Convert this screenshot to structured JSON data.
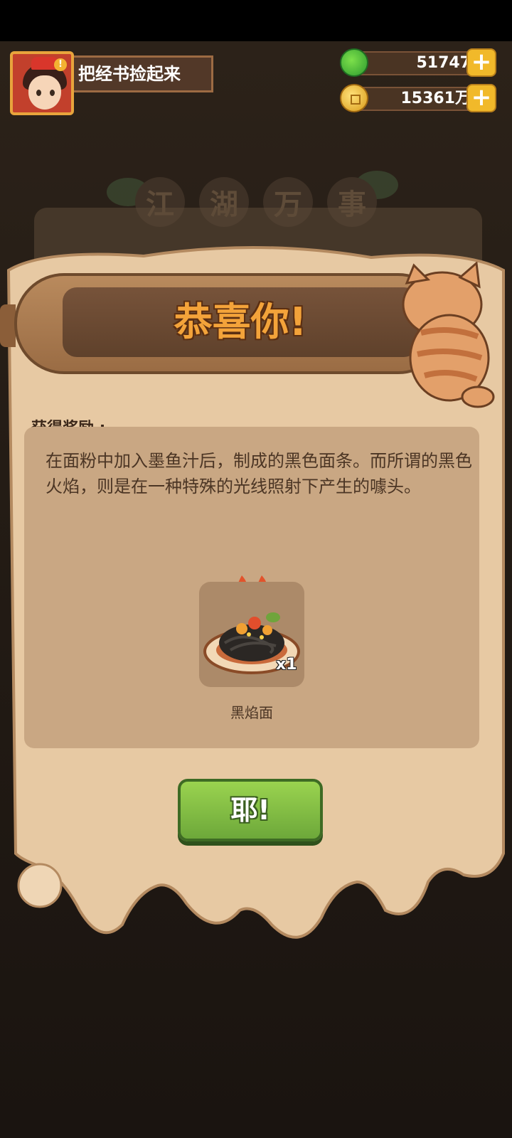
{
  "background": {
    "title_chars": [
      "江",
      "湖",
      "万",
      "事"
    ]
  },
  "player": {
    "quest_title": "把经书捡起来",
    "avatar_badge": "!"
  },
  "currency": {
    "jade": {
      "icon": "jade-icon",
      "value": "51747"
    },
    "coins": {
      "icon": "coin-icon",
      "value": "15361万"
    },
    "add_label": "+"
  },
  "dialog": {
    "title": "恭喜你!",
    "reward_label": "获得奖励 :",
    "description": "在面粉中加入墨鱼汁后，制成的黑色面条。而所谓的黑色火焰，则是在一种特殊的光线照射下产生的噱头。",
    "item": {
      "name": "黑焰面",
      "quantity": "x1",
      "icon": "black-noodle-icon",
      "flames": 2
    },
    "confirm_label": "耶!"
  },
  "colors": {
    "accent_orange": "#f3a33a",
    "button_green": "#7fc044",
    "parchment": "#e7c9a3",
    "panel": "#c9a783"
  }
}
